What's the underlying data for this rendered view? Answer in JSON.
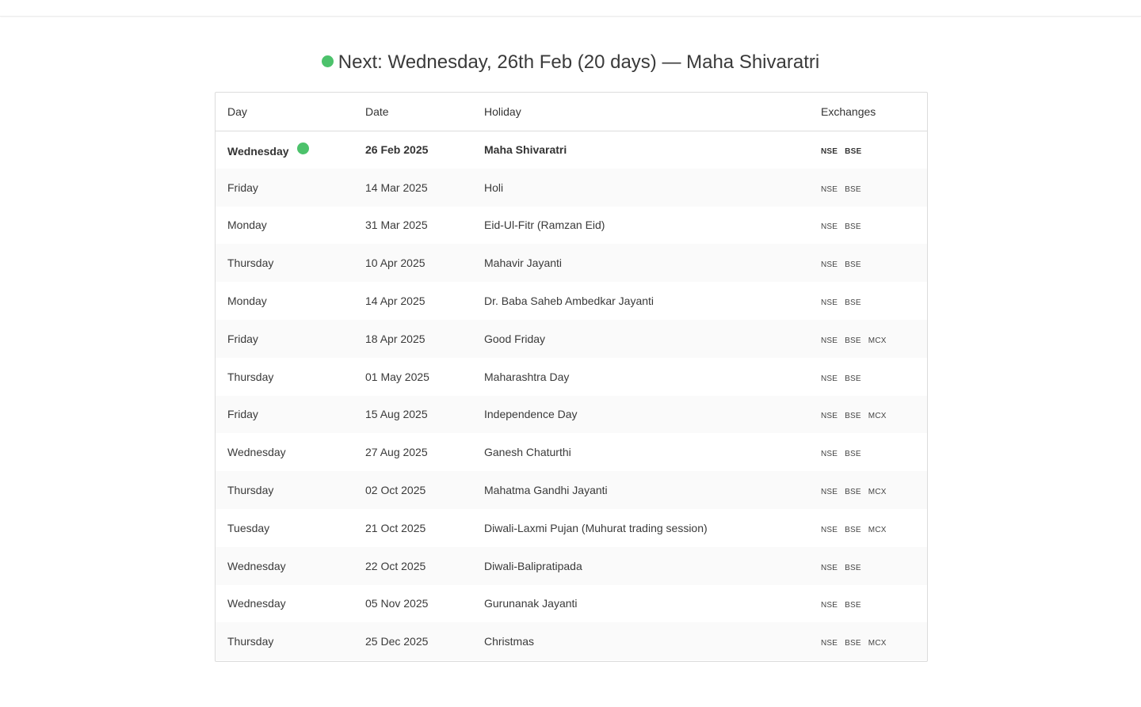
{
  "colors": {
    "accent_green": "#4cc26b",
    "border": "#dcdcdc",
    "stripe": "#fafafa"
  },
  "headline": {
    "text": "Next: Wednesday, 26th Feb (20 days) — Maha Shivaratri",
    "status_icon": "green-dot-icon"
  },
  "table": {
    "columns": [
      "Day",
      "Date",
      "Holiday",
      "Exchanges"
    ],
    "rows": [
      {
        "day": "Wednesday",
        "date": "26 Feb 2025",
        "holiday": "Maha Shivaratri",
        "exchanges": [
          "NSE",
          "BSE"
        ],
        "next": true
      },
      {
        "day": "Friday",
        "date": "14 Mar 2025",
        "holiday": "Holi",
        "exchanges": [
          "NSE",
          "BSE"
        ]
      },
      {
        "day": "Monday",
        "date": "31 Mar 2025",
        "holiday": "Eid-Ul-Fitr (Ramzan Eid)",
        "exchanges": [
          "NSE",
          "BSE"
        ]
      },
      {
        "day": "Thursday",
        "date": "10 Apr 2025",
        "holiday": "Mahavir Jayanti",
        "exchanges": [
          "NSE",
          "BSE"
        ]
      },
      {
        "day": "Monday",
        "date": "14 Apr 2025",
        "holiday": "Dr. Baba Saheb Ambedkar Jayanti",
        "exchanges": [
          "NSE",
          "BSE"
        ]
      },
      {
        "day": "Friday",
        "date": "18 Apr 2025",
        "holiday": "Good Friday",
        "exchanges": [
          "NSE",
          "BSE",
          "MCX"
        ]
      },
      {
        "day": "Thursday",
        "date": "01 May 2025",
        "holiday": "Maharashtra Day",
        "exchanges": [
          "NSE",
          "BSE"
        ]
      },
      {
        "day": "Friday",
        "date": "15 Aug 2025",
        "holiday": "Independence Day",
        "exchanges": [
          "NSE",
          "BSE",
          "MCX"
        ]
      },
      {
        "day": "Wednesday",
        "date": "27 Aug 2025",
        "holiday": "Ganesh Chaturthi",
        "exchanges": [
          "NSE",
          "BSE"
        ]
      },
      {
        "day": "Thursday",
        "date": "02 Oct 2025",
        "holiday": "Mahatma Gandhi Jayanti",
        "exchanges": [
          "NSE",
          "BSE",
          "MCX"
        ]
      },
      {
        "day": "Tuesday",
        "date": "21 Oct 2025",
        "holiday": "Diwali-Laxmi Pujan (Muhurat trading session)",
        "exchanges": [
          "NSE",
          "BSE",
          "MCX"
        ]
      },
      {
        "day": "Wednesday",
        "date": "22 Oct 2025",
        "holiday": "Diwali-Balipratipada",
        "exchanges": [
          "NSE",
          "BSE"
        ]
      },
      {
        "day": "Wednesday",
        "date": "05 Nov 2025",
        "holiday": "Gurunanak Jayanti",
        "exchanges": [
          "NSE",
          "BSE"
        ]
      },
      {
        "day": "Thursday",
        "date": "25 Dec 2025",
        "holiday": "Christmas",
        "exchanges": [
          "NSE",
          "BSE",
          "MCX"
        ]
      }
    ]
  }
}
